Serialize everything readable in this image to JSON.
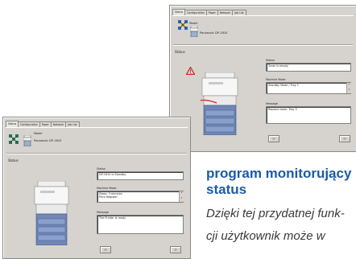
{
  "back_window": {
    "tabs": [
      "Status",
      "Configuration",
      "Paper",
      "Network",
      "Job List"
    ],
    "model_label": "Model",
    "model_value": "Panasonic DP-1810",
    "status_label": "Status",
    "fields": [
      {
        "label": "Status",
        "line1": "Toner is empty",
        "line2": ""
      },
      {
        "label": "Machine Mode",
        "line1": "Standby Mode / Tray 1",
        "line2": ""
      },
      {
        "label": "Message",
        "line1": "Replace toner. Tray 3",
        "line2": ""
      }
    ]
  },
  "front_window": {
    "tabs": [
      "Status",
      "Configuration",
      "Paper",
      "Network",
      "Job List"
    ],
    "model_label": "Model",
    "model_value": "Panasonic DP-1810",
    "status_label": "Status",
    "fields": [
      {
        "label": "Status",
        "line1": "DP-1810 is Standby",
        "line2": ""
      },
      {
        "label": "Machine Mode",
        "line1": "Sleep: 3 minutes",
        "line2": "Print Register"
      },
      {
        "label": "Message",
        "line1": "The Printer is ready",
        "line2": ""
      }
    ]
  },
  "article": {
    "title_line1": "program monitorujący",
    "title_line2": "status",
    "body_line1": "Dzięki tej przydatnej funk-",
    "body_line2": "cji  użytkownik  może  w"
  },
  "colors": {
    "title_blue": "#1c5aa6",
    "window_grey": "#d6d3ce",
    "warning_red": "#cc2222"
  }
}
